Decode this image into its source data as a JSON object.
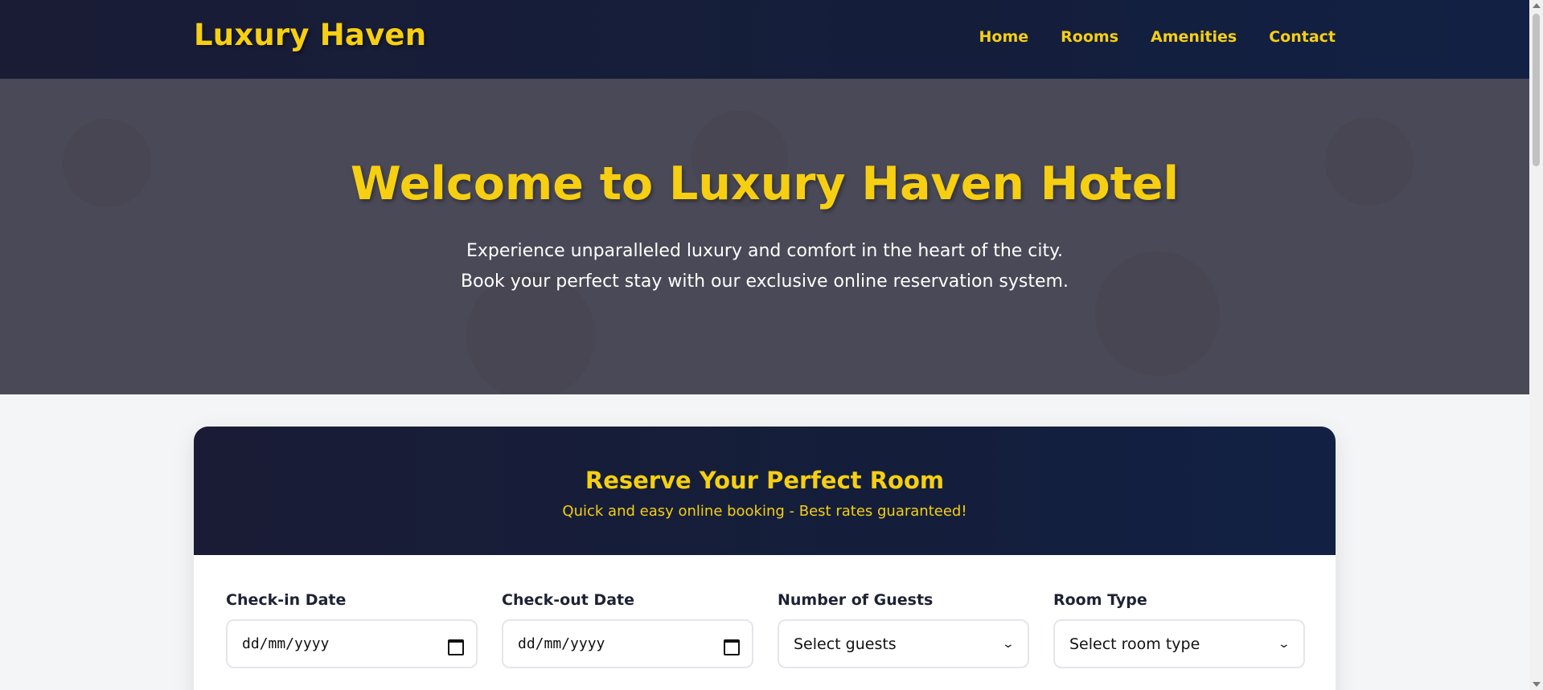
{
  "header": {
    "brand": "Luxury Haven",
    "nav": [
      "Home",
      "Rooms",
      "Amenities",
      "Contact"
    ]
  },
  "hero": {
    "title": "Welcome to Luxury Haven Hotel",
    "line1": "Experience unparalleled luxury and comfort in the heart of the city.",
    "line2": "Book your perfect stay with our exclusive online reservation system."
  },
  "booking": {
    "title": "Reserve Your Perfect Room",
    "subtitle": "Quick and easy online booking - Best rates guaranteed!",
    "checkin": {
      "label": "Check-in Date",
      "value": "dd/mm/yyyy"
    },
    "checkout": {
      "label": "Check-out Date",
      "value": "dd/mm/yyyy"
    },
    "guests": {
      "label": "Number of Guests",
      "value": "Select guests"
    },
    "room_type": {
      "label": "Room Type",
      "value": "Select room type"
    }
  },
  "icons": {
    "date_picker": "calendar-icon",
    "select": "chevron-down-icon"
  },
  "colors": {
    "accent": "#f6cf12",
    "header_bg": "#151d3a",
    "hero_bg": "#4a4957"
  }
}
